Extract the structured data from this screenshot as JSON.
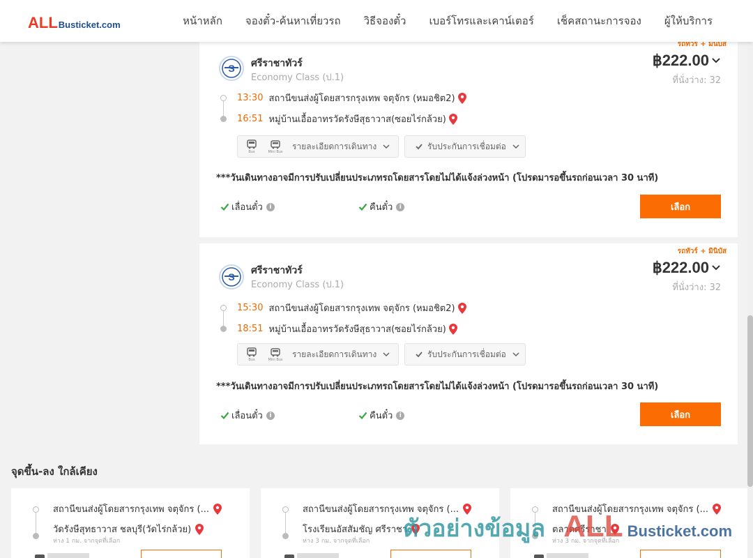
{
  "header": {
    "logo_all": "ALL",
    "logo_rest": "Busticket.com",
    "nav": [
      "หน้าหลัก",
      "จองตั๋ว-ค้นหาเที่ยวรถ",
      "วิธีจองตั๋ว",
      "เบอร์โทรและเคาน์เตอร์",
      "เช็คสถานะการจอง",
      "ผู้ให้บริการ"
    ]
  },
  "trips": [
    {
      "tag": "รถทัวร์ + มินิบัส",
      "operator": "ศรีราชาทัวร์",
      "class": "Economy Class (ป.1)",
      "price": "฿222.00",
      "seats_label": "ที่นั่งว่าง:",
      "seats": "32",
      "depart_time": "13:30",
      "depart_place": "สถานีขนส่งผู้โดยสารกรุงเทพ จตุจักร (หมอชิต2)",
      "arrive_time": "16:51",
      "arrive_place": "หมู่บ้านเอื้ออาทรวัดรังษีสุธาวาส(ซอยไร่กล้วย)",
      "bus_label": "Bus",
      "minibus_label": "Mini Bus",
      "details_label": "รายละเอียดการเดินทาง",
      "insurance_label": "รับประกันการเชื่อมต่อ",
      "notice": "***วันเดินทางอาจมีการปรับเปลี่ยนประเภทรถโดยสารโดยไม่ได้แจ้งล่วงหน้า (โปรดมารอขึ้นรถก่อนเวลา 30 นาที)",
      "policy_postpone": "เลื่อนตั๋ว",
      "policy_refund": "คืนตั๋ว",
      "select_label": "เลือก"
    },
    {
      "tag": "รถทัวร์ + มินิบัส",
      "operator": "ศรีราชาทัวร์",
      "class": "Economy Class (ป.1)",
      "price": "฿222.00",
      "seats_label": "ที่นั่งว่าง:",
      "seats": "32",
      "depart_time": "15:30",
      "depart_place": "สถานีขนส่งผู้โดยสารกรุงเทพ จตุจักร (หมอชิต2)",
      "arrive_time": "18:51",
      "arrive_place": "หมู่บ้านเอื้ออาทรวัดรังษีสุธาวาส(ซอยไร่กล้วย)",
      "bus_label": "Bus",
      "minibus_label": "Mini Bus",
      "details_label": "รายละเอียดการเดินทาง",
      "insurance_label": "รับประกันการเชื่อมต่อ",
      "notice": "***วันเดินทางอาจมีการปรับเปลี่ยนประเภทรถโดยสารโดยไม่ได้แจ้งล่วงหน้า (โปรดมารอขึ้นรถก่อนเวลา 30 นาที)",
      "policy_postpone": "เลื่อนตั๋ว",
      "policy_refund": "คืนตั๋ว",
      "select_label": "เลือก"
    }
  ],
  "nearby": {
    "title": "จุดขึ้น-ลง ใกล้เคียง",
    "items": [
      {
        "from": "สถานีขนส่งผู้โดยสารกรุงเทพ จตุจักร (...",
        "to": "วัดรังษีสุทธาวาส ชลบุรี(วัดไร่กล้วย)",
        "distance": "ห่าง 1 กม. จากจุดที่เลือก"
      },
      {
        "from": "สถานีขนส่งผู้โดยสารกรุงเทพ จตุจักร (...",
        "to": "โรงเรียนอัสสัมชัญ ศรีราชา",
        "distance": "ห่าง 3 กม. จากจุดที่เลือก"
      },
      {
        "from": "สถานีขนส่งผู้โดยสารกรุงเทพ จตุจักร (...",
        "to": "ตลาดศรีราชา",
        "distance": "ห่าง 3 กม. จากจุดที่เลือก"
      }
    ]
  },
  "watermark": {
    "thai": "ตัวอย่างข้อมูล",
    "all": "ALL",
    "rest": "Busticket.com"
  },
  "colors": {
    "accent": "#fb6c02",
    "time": "#f26a00",
    "logo_red": "#ee3a23",
    "logo_blue": "#1d4f8c",
    "check": "#3aa745",
    "pin": "#e8383d"
  }
}
